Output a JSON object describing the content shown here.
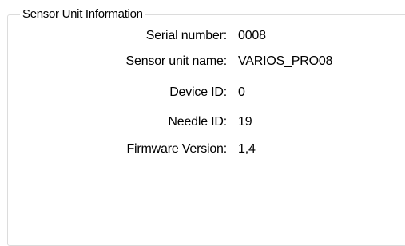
{
  "group": {
    "title": "Sensor Unit Information",
    "fields": [
      {
        "label": "Serial number:",
        "value": "0008"
      },
      {
        "label": "Sensor unit name:",
        "value": "VARIOS_PRO08"
      },
      {
        "label": "Device ID:",
        "value": "0"
      },
      {
        "label": "Needle ID:",
        "value": "19"
      },
      {
        "label": "Firmware Version:",
        "value": "1,4"
      }
    ]
  }
}
